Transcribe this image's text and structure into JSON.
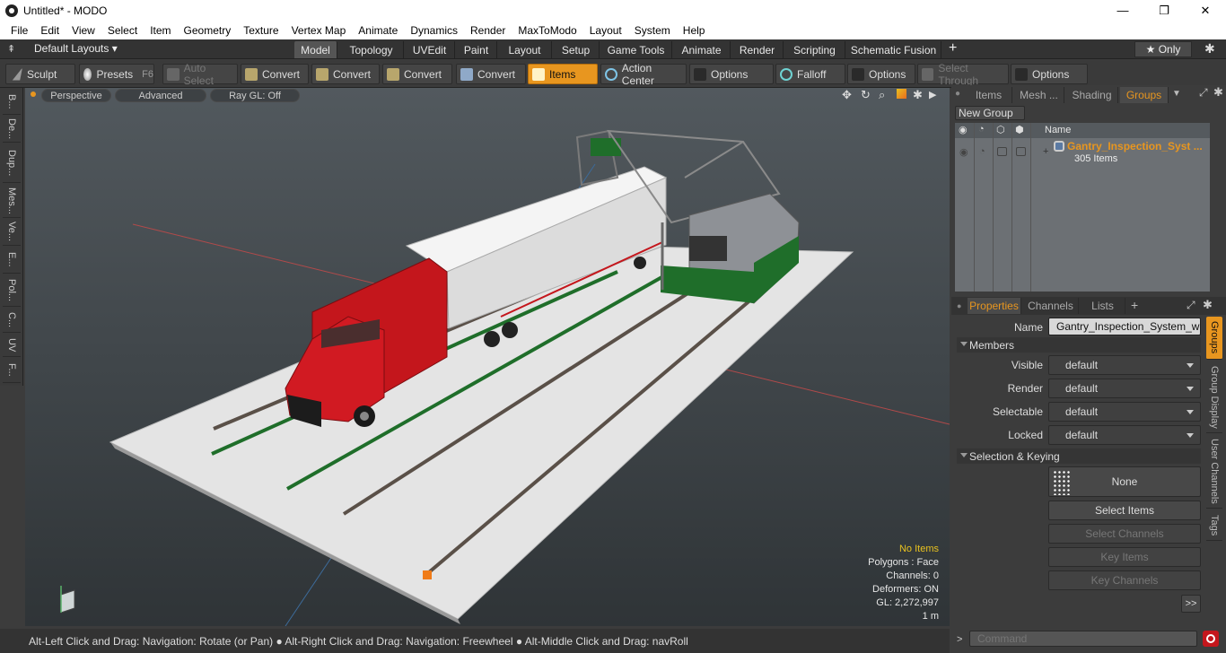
{
  "window": {
    "title": "Untitled* - MODO",
    "minimize": "—",
    "maximize": "❐",
    "close": "✕"
  },
  "menu": [
    "File",
    "Edit",
    "View",
    "Select",
    "Item",
    "Geometry",
    "Texture",
    "Vertex Map",
    "Animate",
    "Dynamics",
    "Render",
    "MaxToModo",
    "Layout",
    "System",
    "Help"
  ],
  "layoutbar": {
    "layouts_label": "Default Layouts ▾",
    "tabs": [
      "Model",
      "Topology",
      "UVEdit",
      "Paint",
      "Layout",
      "Setup",
      "Game Tools",
      "Animate",
      "Render",
      "Scripting",
      "Schematic Fusion"
    ],
    "active_tab": "Model",
    "add": "+",
    "only": "★ Only",
    "gear": "✱"
  },
  "toolbar": {
    "sculpt": "Sculpt",
    "presets": "Presets",
    "presets_key": "F6",
    "auto_select": "Auto Select",
    "convert1": "Convert",
    "convert2": "Convert",
    "convert3": "Convert",
    "convert4": "Convert",
    "items": "Items",
    "action_center": "Action Center",
    "options1": "Options",
    "falloff": "Falloff",
    "options2": "Options",
    "select_through": "Select Through",
    "options3": "Options"
  },
  "left_tabs": [
    "B...",
    "De...",
    "Dup...",
    "Mes...",
    "Ve...",
    "E...",
    "Pol...",
    "C...",
    "UV",
    "F..."
  ],
  "viewport": {
    "perspective": "Perspective",
    "advanced": "Advanced",
    "raygl": "Ray GL: Off",
    "info": {
      "no_items": "No Items",
      "polygons": "Polygons : Face",
      "channels": "Channels: 0",
      "deformers": "Deformers: ON",
      "gl": "GL: 2,272,997",
      "scale": "1 m"
    }
  },
  "statusbar": "Alt-Left Click and Drag: Navigation: Rotate (or Pan) ● Alt-Right Click and Drag: Navigation: Freewheel ● Alt-Middle Click and Drag: navRoll",
  "right_panel": {
    "top_tabs": [
      "Items",
      "Mesh ...",
      "Shading",
      "Groups"
    ],
    "top_active": "Groups",
    "new_group": "New Group",
    "name_col": "Name",
    "group_name": "Gantry_Inspection_Syst ...",
    "group_count": "305 Items",
    "prop_tabs": [
      "Properties",
      "Channels",
      "Lists"
    ],
    "prop_active": "Properties",
    "name_label": "Name",
    "name_value": "Gantry_Inspection_System_with",
    "members_header": "Members",
    "visible_label": "Visible",
    "render_label": "Render",
    "selectable_label": "Selectable",
    "locked_label": "Locked",
    "dd_value": "default",
    "selection_header": "Selection & Keying",
    "none_btn": "None",
    "select_items": "Select Items",
    "select_channels": "Select Channels",
    "key_items": "Key Items",
    "key_channels": "Key Channels",
    "more": ">>",
    "side_tabs": [
      "Groups",
      "Group Display",
      "User Channels",
      "Tags"
    ],
    "command_placeholder": "Command"
  },
  "colors": {
    "accent": "#e8961f",
    "truck_red": "#c4161c",
    "green": "#1f6e2a"
  }
}
